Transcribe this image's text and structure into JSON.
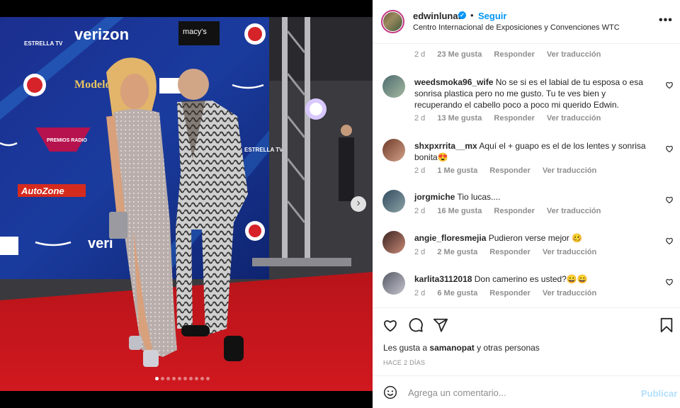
{
  "post": {
    "username": "edwinlunat",
    "verified_icon": "verified-badge-icon",
    "separator": "•",
    "follow_label": "Seguir",
    "location": "Centro Internacional de Exposiciones y Convenciones WTC",
    "more_icon": "more-options-icon",
    "more_glyph": "•••"
  },
  "media": {
    "next_icon": "chevron-right-icon",
    "next_glyph": "›",
    "carousel_total": 10,
    "carousel_active": 1,
    "backdrop_logos": [
      "ESTRELLA TV",
      "verizon",
      "macy's",
      "Modelo",
      "PREMIOS RADIO",
      "AutoZone",
      "veri",
      "ESTRELLA TV"
    ]
  },
  "top_partial": {
    "time": "2 d",
    "likes": "23 Me gusta",
    "reply": "Responder",
    "translate": "Ver traducción"
  },
  "comments": [
    {
      "user": "weedsmoka96_wife",
      "text": "No se si es el labial de tu esposa o esa sonrisa plastica pero no me gusto. Tu te ves bien y recuperando el cabello poco a poco mi querido Edwin.",
      "time": "2 d",
      "likes": "13 Me gusta",
      "reply": "Responder",
      "translate": "Ver traducción"
    },
    {
      "user": "shxpxrrita__mx",
      "text": "Aquí el + guapo es el de los lentes y sonrisa bonita😍",
      "time": "2 d",
      "likes": "1 Me gusta",
      "reply": "Responder",
      "translate": "Ver traducción"
    },
    {
      "user": "jorgmiche",
      "text": "Tio lucas....",
      "time": "2 d",
      "likes": "16 Me gusta",
      "reply": "Responder",
      "translate": "Ver traducción"
    },
    {
      "user": "angie_floresmejia",
      "text": "Pudieron verse mejor 🥴",
      "time": "2 d",
      "likes": "2 Me gusta",
      "reply": "Responder",
      "translate": "Ver traducción"
    },
    {
      "user": "karlita3112018",
      "text": "Don camerino es usted?😄😄",
      "time": "2 d",
      "likes": "6 Me gusta",
      "reply": "Responder",
      "translate": "Ver traducción"
    }
  ],
  "actions": {
    "like_icon": "heart-icon",
    "comment_icon": "comment-icon",
    "share_icon": "share-icon",
    "save_icon": "bookmark-icon",
    "likes_prefix": "Les gusta a",
    "likes_user": "samanopat",
    "likes_suffix": "y otras personas",
    "posted_ago": "HACE 2 DÍAS"
  },
  "composer": {
    "emoji_icon": "emoji-icon",
    "placeholder": "Agrega un comentario...",
    "publish_label": "Publicar"
  },
  "colors": {
    "accent": "#0095f6",
    "muted": "#8e8e8e",
    "publish_disabled": "#b2dffc",
    "carpet": "#c8141c",
    "backdrop": "#16348a"
  }
}
